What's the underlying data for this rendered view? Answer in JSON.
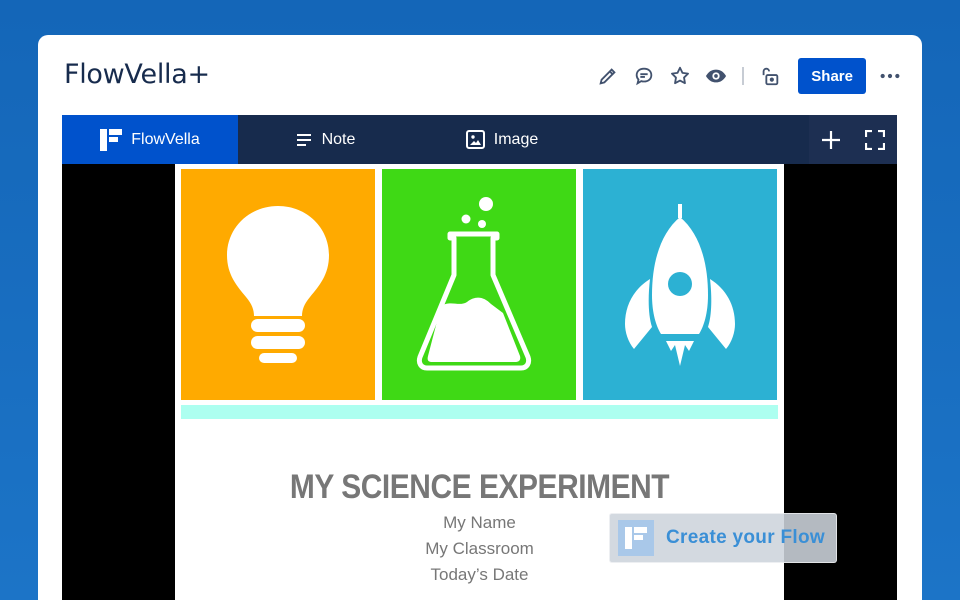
{
  "app": {
    "title": "FlowVella+"
  },
  "toolbar": {
    "icons": [
      "edit-icon",
      "comment-icon",
      "star-icon",
      "watch-icon",
      "restrictions-icon",
      "more-icon"
    ],
    "share_label": "Share"
  },
  "embed": {
    "tabs": [
      {
        "label": "FlowVella",
        "icon": "flowvella-logo-icon",
        "active": true
      },
      {
        "label": "Note",
        "icon": "note-icon",
        "active": false
      },
      {
        "label": "Image",
        "icon": "image-icon",
        "active": false
      }
    ],
    "actions": [
      "plus-icon",
      "fullscreen-icon"
    ]
  },
  "slide": {
    "title": "MY SCIENCE EXPERIMENT",
    "lines": [
      "My Name",
      "My Classroom",
      "Today’s Date"
    ],
    "panels": [
      {
        "icon": "lightbulb-icon",
        "color": "#ffaa00"
      },
      {
        "icon": "flask-icon",
        "color": "#3fd915"
      },
      {
        "icon": "rocket-icon",
        "color": "#2cb1d3"
      }
    ],
    "strip_color": "#adfff0"
  },
  "cta": {
    "label": "Create your Flow"
  },
  "colors": {
    "brand": "#0052cc",
    "bar": "#172b4d",
    "background": "#1466b8"
  }
}
